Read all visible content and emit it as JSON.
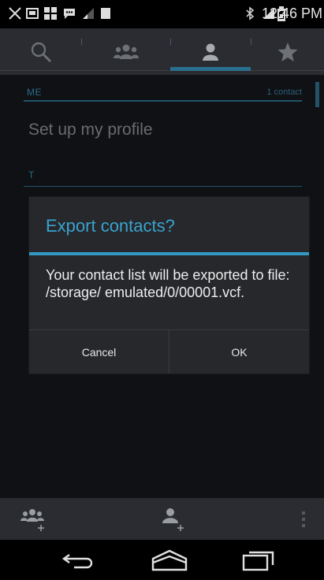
{
  "status_bar": {
    "time": "12:46 PM",
    "left_icons": [
      "missed-call-icon",
      "screenshot-icon",
      "network-icon",
      "sms-icon",
      "signal-weak-icon",
      "notification-icon"
    ],
    "right_icons": [
      "bluetooth-icon",
      "mobile-signal-icon",
      "battery-icon"
    ]
  },
  "tabs": [
    {
      "name": "search",
      "icon": "search-icon"
    },
    {
      "name": "groups",
      "icon": "groups-icon"
    },
    {
      "name": "contacts",
      "icon": "person-icon",
      "selected": true
    },
    {
      "name": "favorites",
      "icon": "star-icon"
    }
  ],
  "list": {
    "me_header": "ME",
    "me_count": "1 contact",
    "profile_setup": "Set up my profile",
    "t_header": "T"
  },
  "dialog": {
    "title": "Export contacts?",
    "message": "Your contact list will be exported to file: /storage/ emulated/0/00001.vcf.",
    "cancel": "Cancel",
    "ok": "OK"
  },
  "action_bar": {
    "add_group_icon": "add-group-icon",
    "add_contact_icon": "add-contact-icon",
    "overflow_icon": "overflow-menu-icon"
  },
  "nav_bar": {
    "back": "back-icon",
    "home": "home-icon",
    "recents": "recent-apps-icon"
  },
  "colors": {
    "accent": "#3498c3",
    "dialog_bg": "#26282c",
    "background": "#15171c"
  }
}
